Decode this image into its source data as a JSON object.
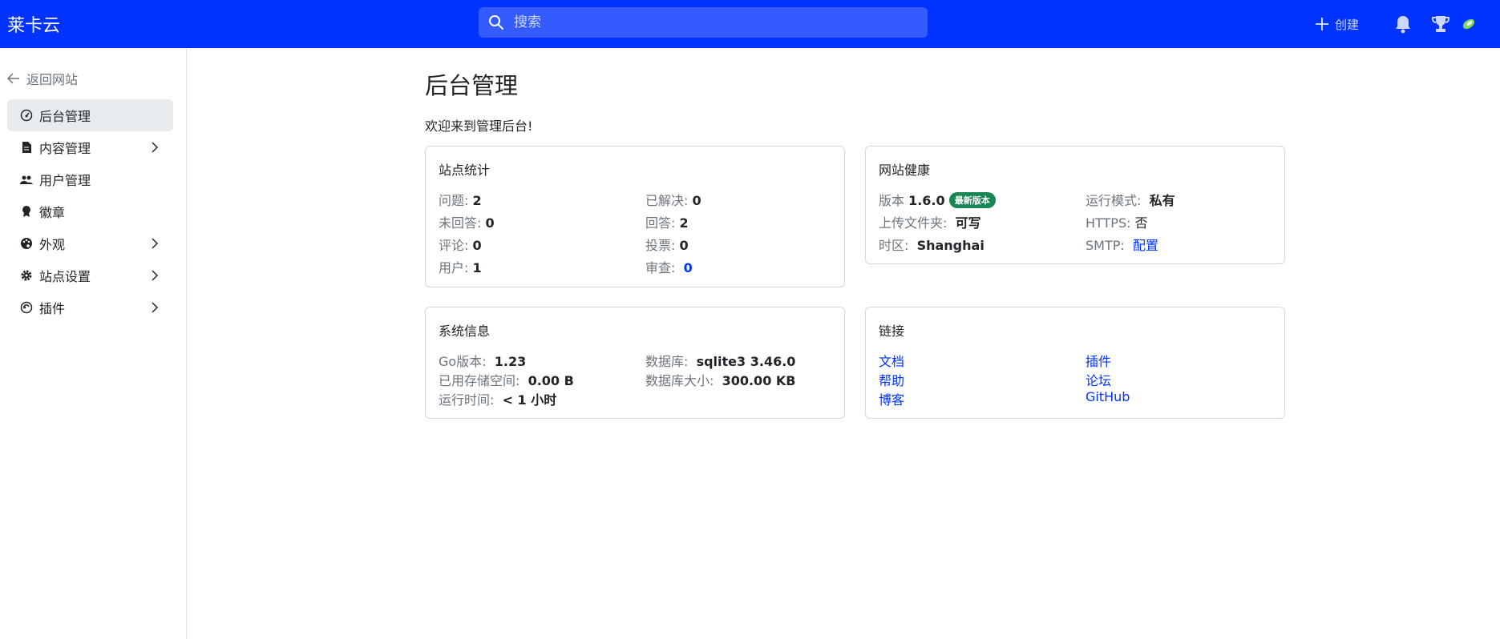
{
  "header": {
    "brand": "莱卡云",
    "search_placeholder": "搜索",
    "create_label": "创建"
  },
  "sidebar": {
    "back_label": "返回网站",
    "items": [
      {
        "label": "后台管理",
        "icon": "gauge-icon",
        "active": true
      },
      {
        "label": "内容管理",
        "icon": "file-icon",
        "has_children": true
      },
      {
        "label": "用户管理",
        "icon": "people-icon"
      },
      {
        "label": "徽章",
        "icon": "award-icon"
      },
      {
        "label": "外观",
        "icon": "palette-icon",
        "has_children": true
      },
      {
        "label": "站点设置",
        "icon": "gear-icon",
        "has_children": true
      },
      {
        "label": "插件",
        "icon": "plugin-icon",
        "has_children": true
      }
    ]
  },
  "main": {
    "title": "后台管理",
    "welcome": "欢迎来到管理后台!",
    "stats": {
      "title": "站点统计",
      "questions_label": "问题: ",
      "questions": "2",
      "resolved_label": "已解决: ",
      "resolved": "0",
      "unanswered_label": "未回答: ",
      "unanswered": "0",
      "answers_label": "回答: ",
      "answers": "2",
      "comments_label": "评论: ",
      "comments": "0",
      "votes_label": "投票: ",
      "votes": "0",
      "users_label": "用户: ",
      "users": "1",
      "review_label": "审查: ",
      "review": "0"
    },
    "health": {
      "title": "网站健康",
      "version_label": "版本 ",
      "version": "1.6.0",
      "version_badge": "最新版本",
      "mode_label": "运行模式: ",
      "mode": "私有",
      "upload_label": "上传文件夹: ",
      "upload": "可写",
      "https_label": "HTTPS: ",
      "https": "否",
      "timezone_label": "时区: ",
      "timezone": "Shanghai",
      "smtp_label": "SMTP: ",
      "smtp": "配置"
    },
    "system": {
      "title": "系统信息",
      "go_label": "Go版本: ",
      "go": "1.23",
      "db_label": "数据库: ",
      "db": "sqlite3 3.46.0",
      "storage_label": "已用存储空间: ",
      "storage": "0.00 B",
      "db_size_label": "数据库大小: ",
      "db_size": "300.00 KB",
      "uptime_label": "运行时间: ",
      "uptime": "< 1 小时"
    },
    "links": {
      "title": "链接",
      "items": [
        "文档",
        "插件",
        "帮助",
        "论坛",
        "博客",
        "GitHub"
      ]
    }
  },
  "colors": {
    "primary": "#0033ff",
    "success": "#198754",
    "muted": "#6c757d"
  }
}
